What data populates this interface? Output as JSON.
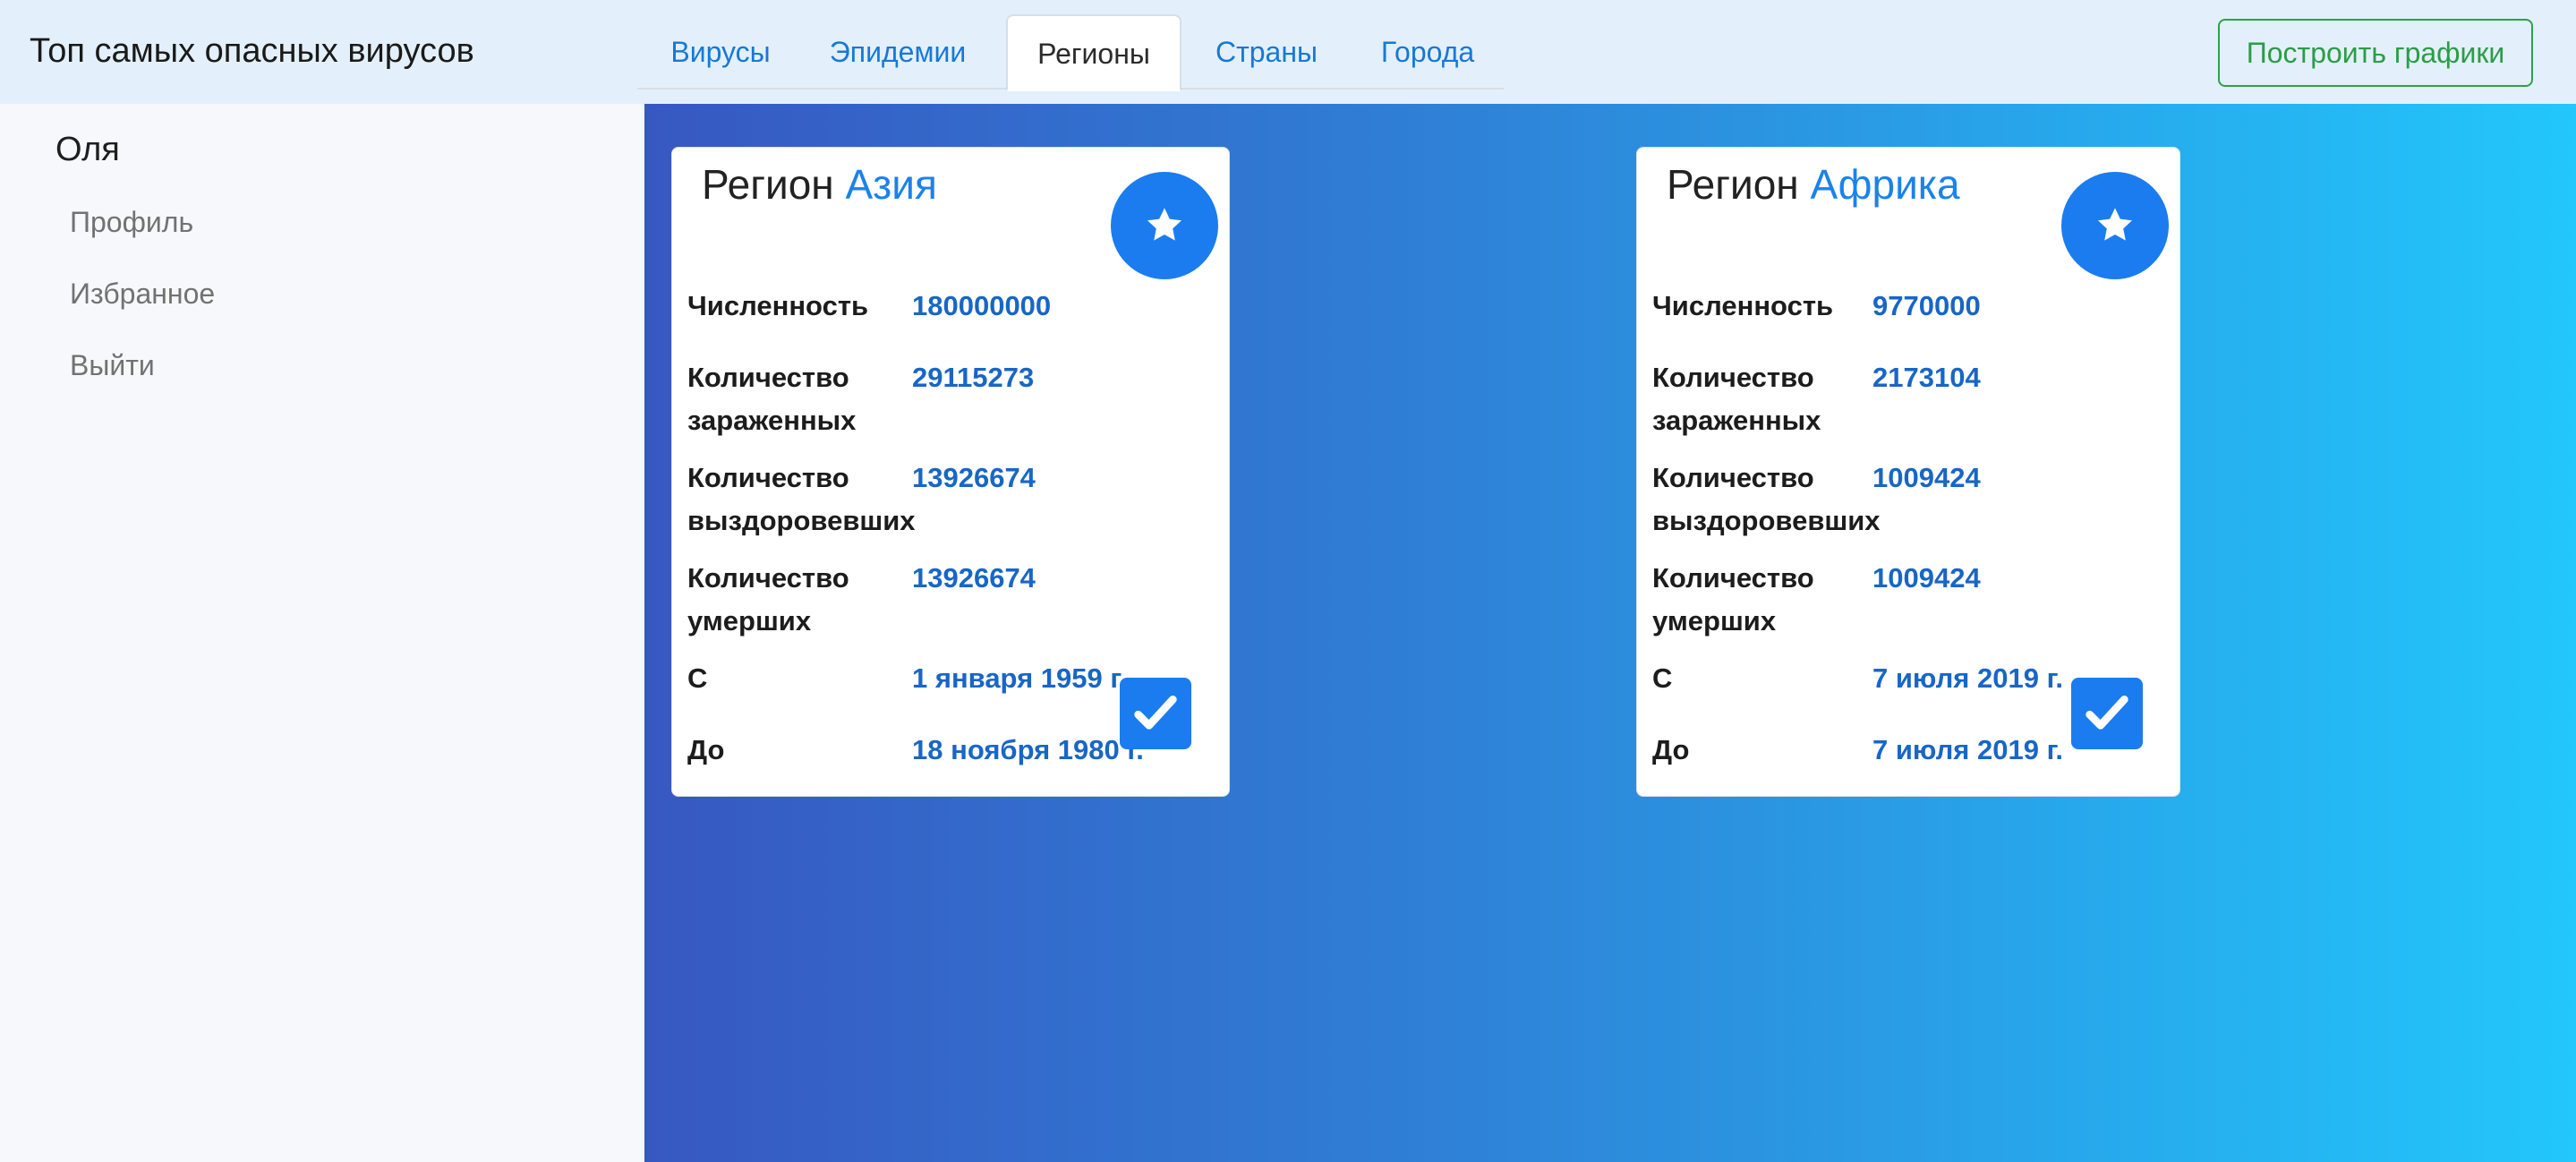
{
  "header": {
    "brand": "Топ самых опасных вирусов",
    "tabs": [
      "Вирусы",
      "Эпидемии",
      "Регионы",
      "Страны",
      "Города"
    ],
    "active_tab": "Регионы",
    "build_button": "Построить графики"
  },
  "sidebar": {
    "user_name": "Оля",
    "links": [
      "Профиль",
      "Избранное",
      "Выйти"
    ]
  },
  "labels": {
    "region_prefix": "Регион",
    "population": "Численность",
    "infected_1": "Количество",
    "infected_2": "зараженных",
    "recovered_1": "Количество",
    "recovered_2": "выздоровевших",
    "deaths_1": "Количество",
    "deaths_2": "умерших",
    "from": "С",
    "to": "До"
  },
  "cards": [
    {
      "name": "Азия",
      "population": "180000000",
      "infected": "29115273",
      "recovered": "13926674",
      "deaths": "13926674",
      "from": "1 января 1959 г.",
      "to": "18 ноября 1980 г."
    },
    {
      "name": "Африка",
      "population": "9770000",
      "infected": "2173104",
      "recovered": "1009424",
      "deaths": "1009424",
      "from": "7 июля 2019 г.",
      "to": "7 июля 2019 г."
    }
  ],
  "colors": {
    "accent": "#1b7cf0",
    "success": "#2ca24a",
    "value_text": "#1866c6"
  },
  "icons": {
    "favorite": "star-icon",
    "selected": "checkmark-icon"
  }
}
